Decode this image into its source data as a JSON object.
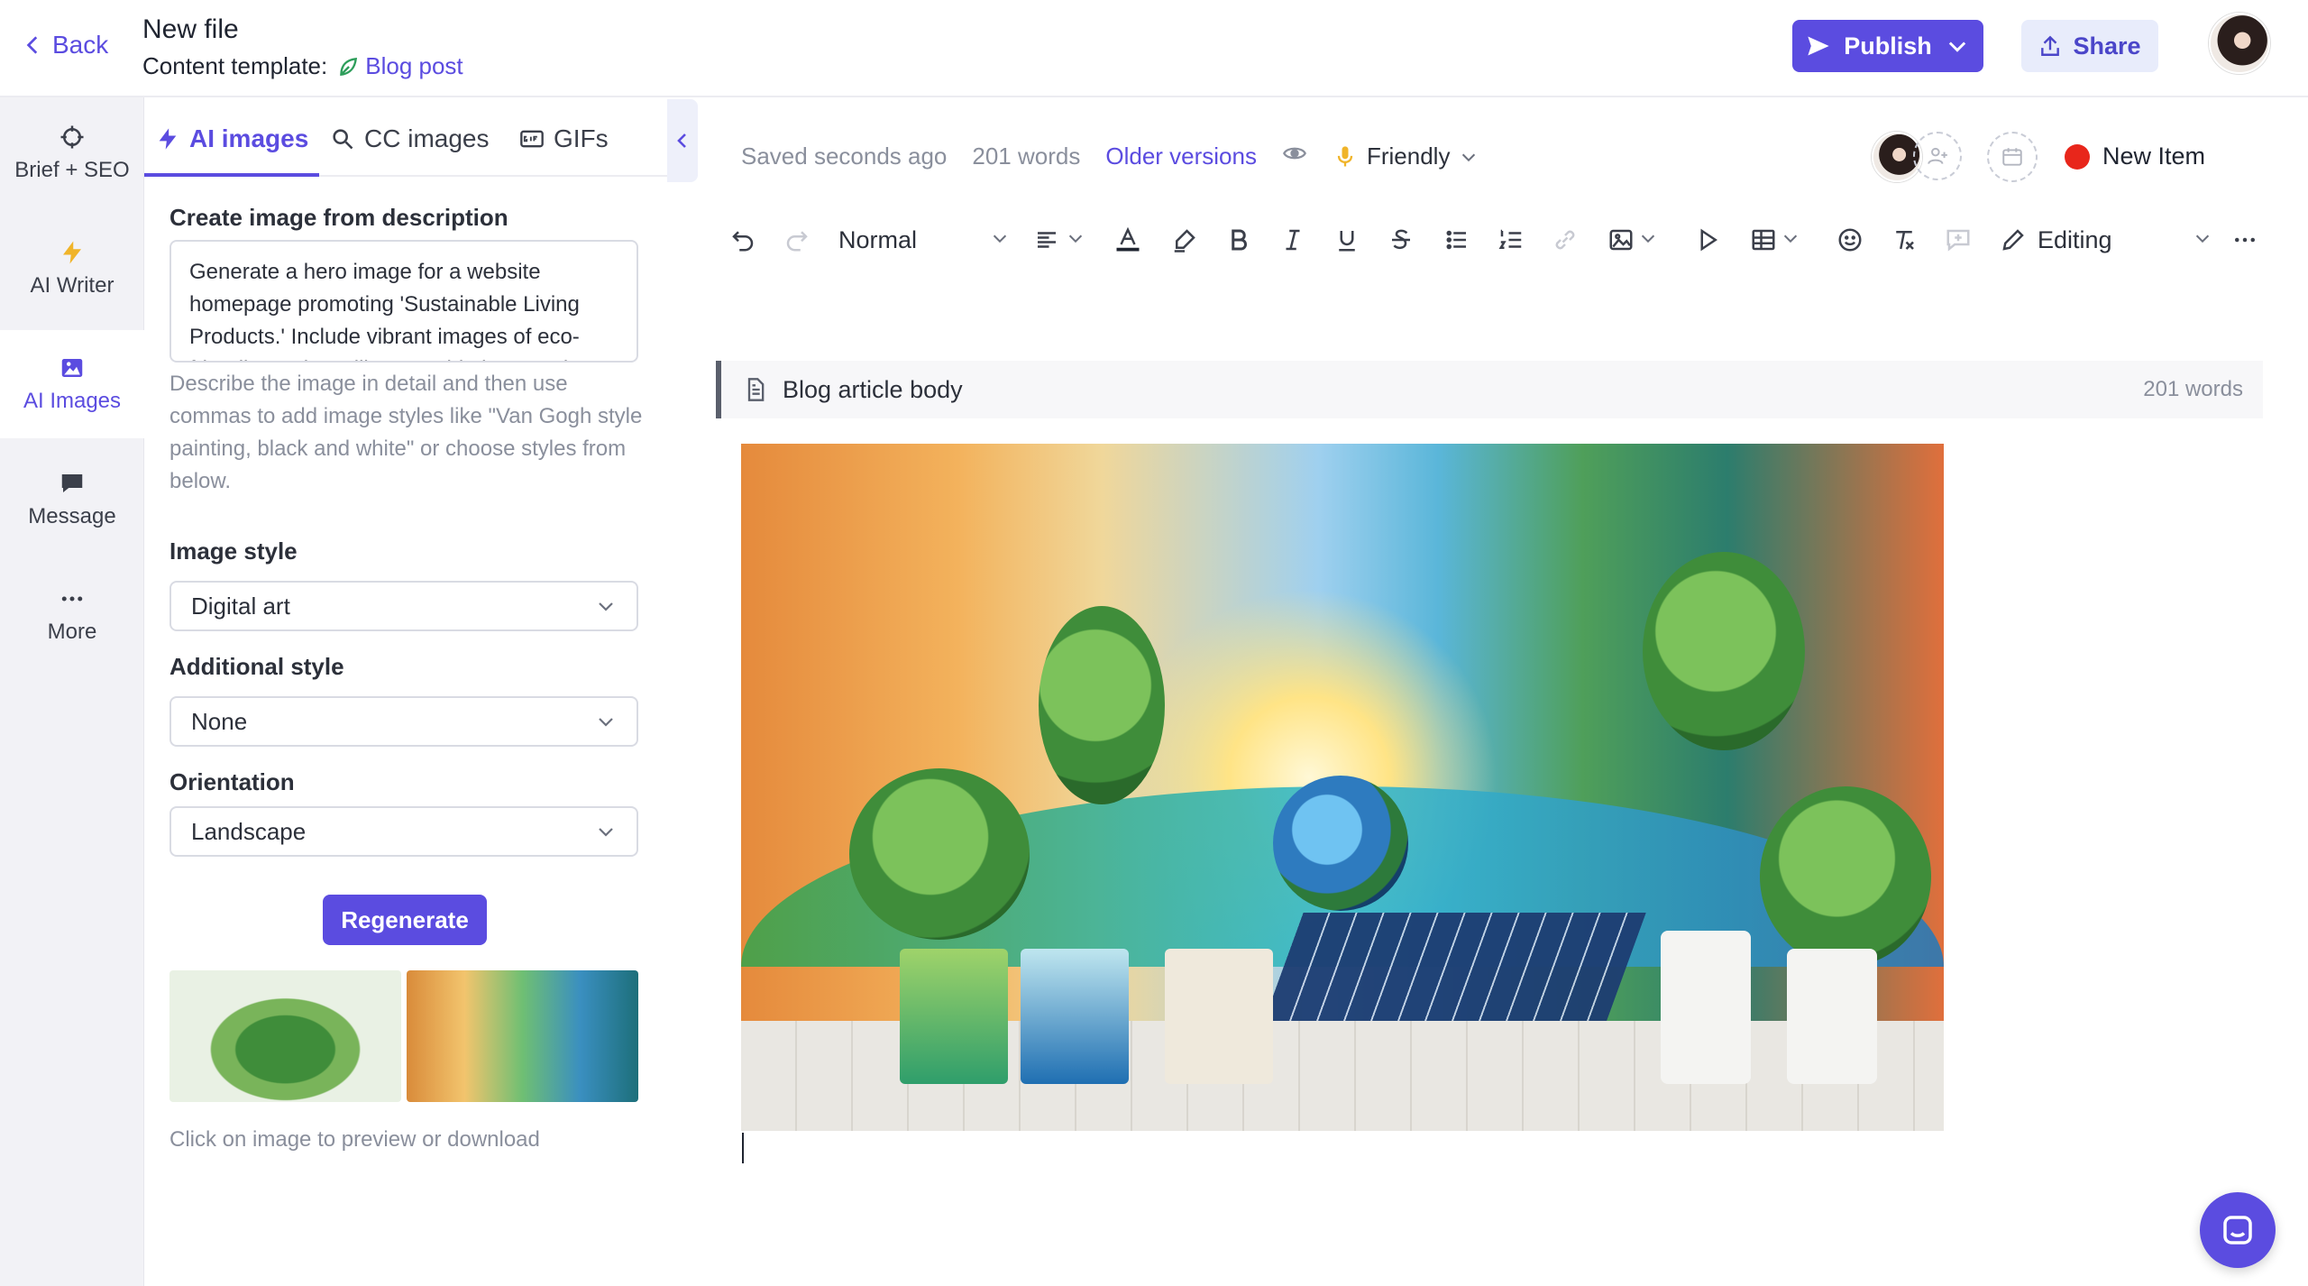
{
  "header": {
    "back_label": "Back",
    "file_title": "New file",
    "template_label": "Content template:",
    "template_name": "Blog post",
    "publish_label": "Publish",
    "share_label": "Share"
  },
  "rail": {
    "items": [
      {
        "label": "Brief + SEO",
        "icon": "crosshair-icon"
      },
      {
        "label": "AI Writer",
        "icon": "lightning-icon"
      },
      {
        "label": "AI Images",
        "icon": "image-icon"
      },
      {
        "label": "Message",
        "icon": "chat-bubble-icon"
      },
      {
        "label": "More",
        "icon": "dots-icon"
      }
    ]
  },
  "panel": {
    "tabs": [
      {
        "label": "AI images",
        "icon": "lightning-icon"
      },
      {
        "label": "CC images",
        "icon": "search-icon"
      },
      {
        "label": "GIFs",
        "icon": "gif-icon"
      }
    ],
    "prompt_label": "Create image from description",
    "prompt_value": "Generate a hero image for a website homepage promoting 'Sustainable Living Products.' Include vibrant images of eco-friendly products like reusable bags, solar panels, and natural skincare",
    "hint": "Describe the image in detail and then use commas to add image styles like \"Van Gogh style painting, black and white\" or choose styles from below.",
    "image_style_label": "Image style",
    "image_style_value": "Digital art",
    "additional_style_label": "Additional style",
    "additional_style_value": "None",
    "orientation_label": "Orientation",
    "orientation_value": "Landscape",
    "regenerate_label": "Regenerate",
    "thumb_caption": "Click on image to preview or download"
  },
  "editor": {
    "saved_status": "Saved seconds ago",
    "word_count": "201 words",
    "older_versions": "Older versions",
    "tone": "Friendly",
    "new_item": "New Item",
    "paragraph_style": "Normal",
    "editing_mode": "Editing",
    "doc_section_title": "Blog article body",
    "doc_section_count": "201 words"
  },
  "colors": {
    "accent": "#5b4ce0",
    "share_bg": "#e8ecfb",
    "status_dot": "#e8261b"
  }
}
